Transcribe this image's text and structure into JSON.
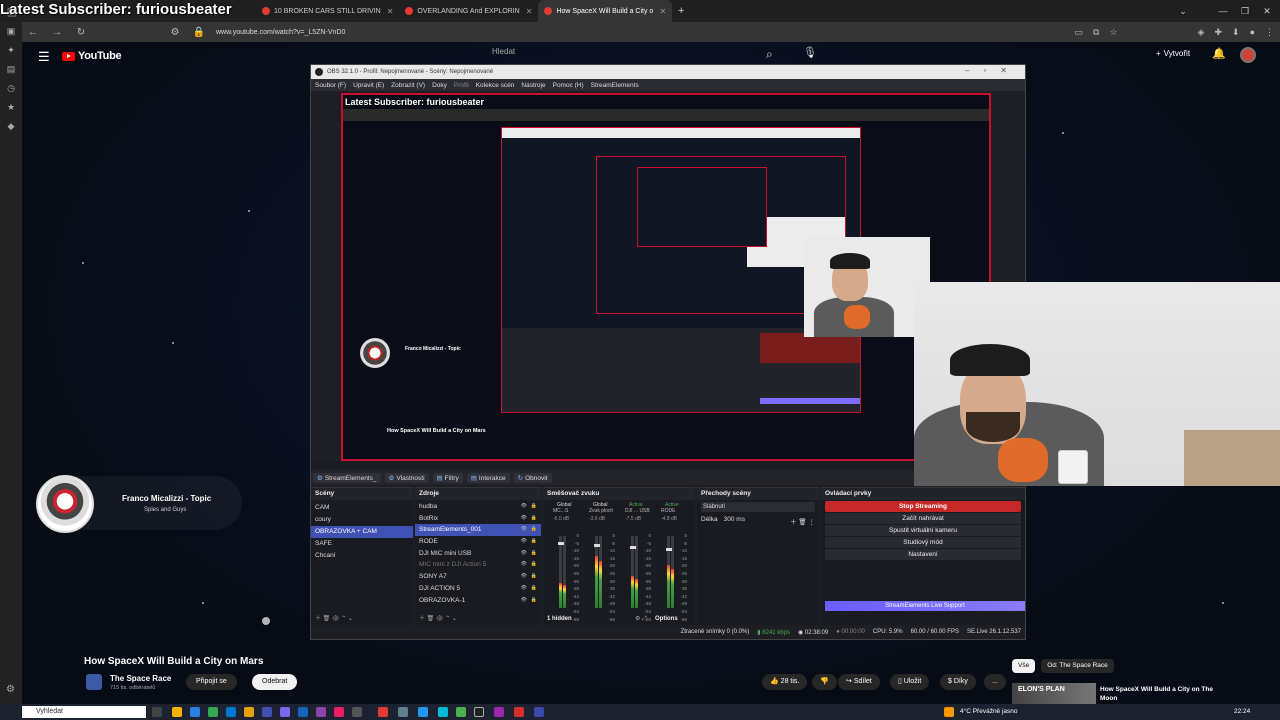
{
  "overlay_title": "Latest Subscriber: furiousbeater",
  "browser": {
    "tabs": [
      {
        "label": "10 BROKEN CARS STILL DRIVIN",
        "active": false
      },
      {
        "label": "OVERLANDING And EXPLORIN",
        "active": false
      },
      {
        "label": "How SpaceX Will Build a City o",
        "active": true
      }
    ],
    "url": "www.youtube.com/watch?v=_L5ZN-VnD0"
  },
  "youtube": {
    "logo_text": "YouTube",
    "search_placeholder": "Hledat",
    "create_label": "Vytvořit",
    "video_title": "How SpaceX Will Build a City on Mars",
    "channel_name": "The Space Race",
    "subscribers": "715 tis. odběratelů",
    "join_label": "Připojit se",
    "unsubscribe_label": "Odebrat",
    "likes": "28 tis.",
    "share_label": "Sdílet",
    "save_label": "Uložit",
    "thanks_label": "Díky",
    "more_label": "...",
    "chips": [
      "Vše",
      "Od: The Space Race"
    ],
    "related": {
      "thumb_text": "ELON'S PLAN",
      "title": "How SpaceX Will Build a City on The Moon"
    },
    "music_card": {
      "name": "Franco Micalizzi - Topic",
      "sub": "Spies and Guys"
    }
  },
  "obs": {
    "title": "OBS 32.1.0 - Profil: Nepojmenované - Scény: Nepojmenované",
    "menu": [
      "Soubor (F)",
      "Upravit (E)",
      "Zobrazit (V)",
      "Doky",
      "Profil",
      "Kolekce scén",
      "Nástroje",
      "Pomoc (H)",
      "StreamElements"
    ],
    "preview_title": "Latest Subscriber: furiousbeater",
    "preview_video_title": "How SpaceX Will Build a City on Mars",
    "preview_channel": "Franco Micalizzi - Topic",
    "toolbar": {
      "source_name": "StreamElements_",
      "props": "Vlastnosti",
      "filters": "Filtry",
      "interact": "Interakce",
      "refresh": "Obnovit"
    },
    "scenes": {
      "header": "Scény",
      "items": [
        {
          "label": "CAM",
          "selected": false
        },
        {
          "label": "coury",
          "selected": false
        },
        {
          "label": "OBRAZOVKA + CAM",
          "selected": true
        },
        {
          "label": "SAFE",
          "selected": false
        },
        {
          "label": "Chcaní",
          "selected": false
        }
      ]
    },
    "sources": {
      "header": "Zdroje",
      "items": [
        {
          "label": "hudba",
          "selected": false,
          "dim": false
        },
        {
          "label": "BotRix",
          "selected": false,
          "dim": false
        },
        {
          "label": "StreamElements_001",
          "selected": true,
          "dim": false
        },
        {
          "label": "RODE",
          "selected": false,
          "dim": false
        },
        {
          "label": "DJI MIC mini USB",
          "selected": false,
          "dim": false
        },
        {
          "label": "MIC mini z DJI Action 5",
          "selected": false,
          "dim": true
        },
        {
          "label": "SONY A7",
          "selected": false,
          "dim": false
        },
        {
          "label": "DJI ACTION 5",
          "selected": false,
          "dim": false
        },
        {
          "label": "OBRAZOVKA-1",
          "selected": false,
          "dim": false
        }
      ]
    },
    "mixer": {
      "header": "Směšovač zvuku",
      "channels": [
        {
          "label": "Global",
          "sub": "MC...S",
          "db": "-5.0 dB",
          "level": 0.35
        },
        {
          "label": "Global",
          "sub": "Zvuk ploch",
          "db": "-3.6 dB",
          "level": 0.72
        },
        {
          "label": "Active",
          "sub": "DJI ... USB",
          "db": "-7.5 dB",
          "level": 0.45
        },
        {
          "label": "Active",
          "sub": "RODE",
          "db": "-4.8 dB",
          "level": 0.6
        }
      ],
      "scale": [
        "0",
        "-5",
        "-10",
        "-15",
        "-20",
        "-25",
        "-30",
        "-35",
        "-42",
        "-48",
        "-54",
        "-60"
      ],
      "footer_hidden": "1 hidden",
      "options_label": "Options"
    },
    "transitions": {
      "header": "Přechody scény",
      "selected": "Slábnutí",
      "duration_label": "Délka",
      "duration_value": "300 ms"
    },
    "controls": {
      "header": "Ovládací prvky",
      "buttons": [
        "Stop Streaming",
        "Začít nahrávat",
        "Spustit virtuální kameru",
        "Studiový mód",
        "Nastavení"
      ],
      "live_support": "StreamElements Live Support"
    },
    "status": {
      "dropped": "Ztracené snímky 0 (0.0%)",
      "bitrate": "8241 kbps",
      "stream_time": "02:38:09",
      "rec_time": "00:00:00",
      "cpu": "CPU: 5.9%",
      "fps": "60.00 / 60.00 FPS",
      "se_version": "SE.Live 26.1.12.537"
    }
  },
  "taskbar": {
    "search_placeholder": "Vyhledat",
    "weather": "4°C  Převážně jasno",
    "clock": "22:24"
  }
}
